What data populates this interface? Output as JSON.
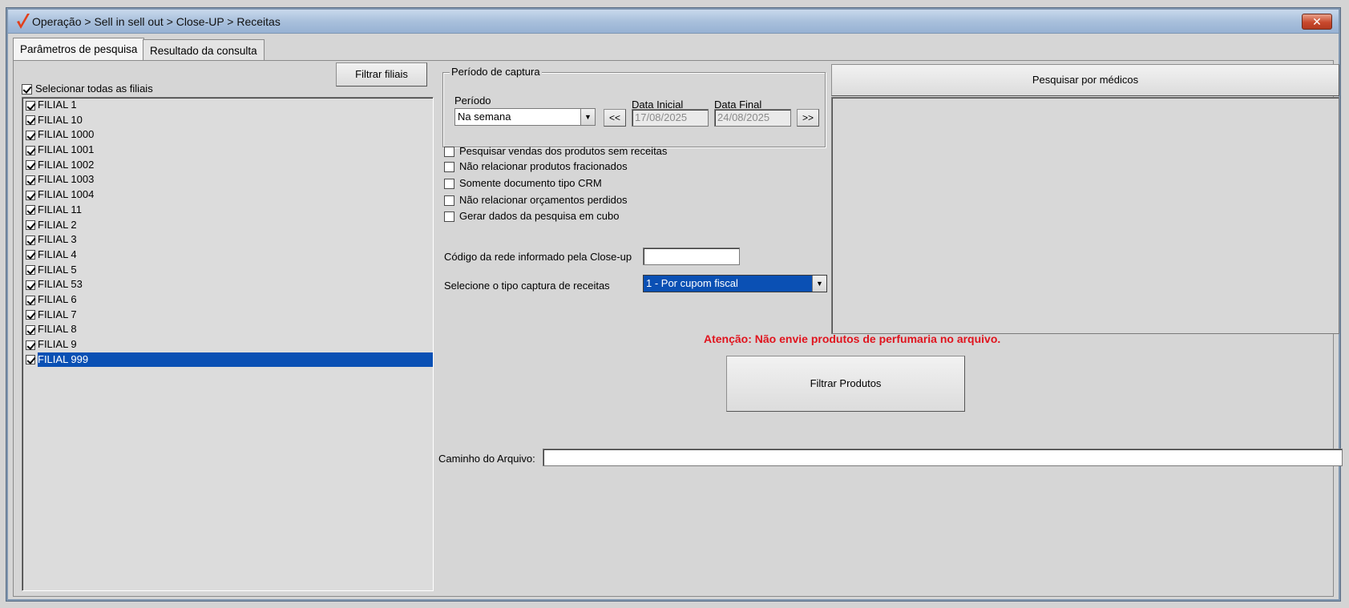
{
  "window": {
    "title": "Operação > Sell in sell out > Close-UP > Receitas",
    "close_label": "✕"
  },
  "tabs": [
    {
      "label": "Parâmetros de pesquisa",
      "active": true
    },
    {
      "label": "Resultado da consulta",
      "active": false
    }
  ],
  "filiais": {
    "filter_button": "Filtrar filiais",
    "select_all_label": "Selecionar todas as filiais",
    "select_all_checked": true,
    "items": [
      {
        "label": "FILIAL 1",
        "checked": true
      },
      {
        "label": "FILIAL 10",
        "checked": true
      },
      {
        "label": "FILIAL 1000",
        "checked": true
      },
      {
        "label": "FILIAL 1001",
        "checked": true
      },
      {
        "label": "FILIAL 1002",
        "checked": true
      },
      {
        "label": "FILIAL 1003",
        "checked": true
      },
      {
        "label": "FILIAL 1004",
        "checked": true
      },
      {
        "label": "FILIAL 11",
        "checked": true
      },
      {
        "label": "FILIAL 2",
        "checked": true
      },
      {
        "label": "FILIAL 3",
        "checked": true
      },
      {
        "label": "FILIAL 4",
        "checked": true
      },
      {
        "label": "FILIAL 5",
        "checked": true
      },
      {
        "label": "FILIAL 53",
        "checked": true
      },
      {
        "label": "FILIAL 6",
        "checked": true
      },
      {
        "label": "FILIAL 7",
        "checked": true
      },
      {
        "label": "FILIAL 8",
        "checked": true
      },
      {
        "label": "FILIAL 9",
        "checked": true
      },
      {
        "label": "FILIAL 999",
        "checked": true,
        "selected": true
      }
    ]
  },
  "periodo_captura": {
    "legend": "Período de captura",
    "periodo_label": "Período",
    "periodo_value": "Na semana",
    "prev_label": "<<",
    "next_label": ">>",
    "data_inicial_label": "Data Inicial",
    "data_inicial_value": "17/08/2025",
    "data_final_label": "Data Final",
    "data_final_value": "24/08/2025"
  },
  "options": [
    {
      "label": "Pesquisar vendas dos produtos sem receitas",
      "checked": false
    },
    {
      "label": "Não relacionar produtos fracionados",
      "checked": false
    },
    {
      "label": "Somente documento tipo CRM",
      "checked": false
    },
    {
      "label": "Não relacionar orçamentos perdidos",
      "checked": false
    },
    {
      "label": "Gerar dados da pesquisa em cubo",
      "checked": false
    }
  ],
  "codigo_rede": {
    "label": "Código da rede informado pela Close-up",
    "value": ""
  },
  "tipo_captura": {
    "label": "Selecione o tipo captura de receitas",
    "value": "1 - Por cupom fiscal"
  },
  "medicos": {
    "button": "Pesquisar por médicos"
  },
  "warning": "Atenção: Não envie produtos de perfumaria no arquivo.",
  "filtrar_produtos": "Filtrar Produtos",
  "caminho": {
    "label": "Caminho do Arquivo:",
    "value": ""
  },
  "colors": {
    "selection": "#0a50b4",
    "warning": "#e0141e",
    "logo": "#e2401c"
  },
  "icons": {
    "app_logo": "check-logo-icon",
    "combo_arrow": "triangle-down-icon"
  }
}
